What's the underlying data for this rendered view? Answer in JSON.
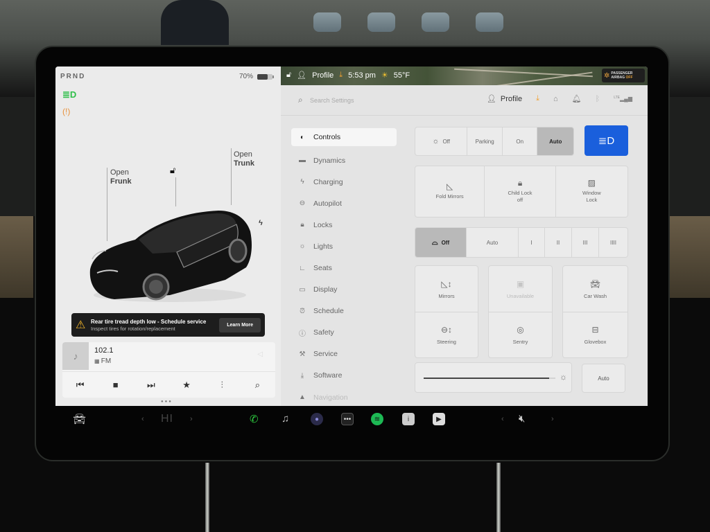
{
  "status": {
    "gear": "PRND",
    "battery_percent_label": "70%",
    "battery_level": 0.7
  },
  "car_view": {
    "frunk": {
      "line1": "Open",
      "line2": "Frunk"
    },
    "trunk": {
      "line1": "Open",
      "line2": "Trunk"
    },
    "lock_icon": "unlocked-lock-icon",
    "charge_icon": "lightning-icon"
  },
  "indicators": {
    "headlight_color": "#2fbf4a",
    "tpms_color": "#e8913a"
  },
  "alert": {
    "title": "Rear tire tread depth low - Schedule service",
    "subtitle": "Inspect tires for rotation/replacement",
    "button": "Learn More"
  },
  "media": {
    "station": "102.1",
    "band": "FM",
    "controls": [
      "previous",
      "stop",
      "next",
      "favorite",
      "equalizer",
      "search"
    ]
  },
  "map_bar": {
    "profile": "Profile",
    "time": "5:53 pm",
    "temperature": "55°F",
    "airbag_line1": "PASSENGER",
    "airbag_line2": "AIRBAG",
    "airbag_state": "OFF"
  },
  "topbar": {
    "search_placeholder": "Search Settings",
    "profile": "Profile",
    "network": "LTE"
  },
  "nav": {
    "items": [
      {
        "label": "Controls",
        "icon": "toggle-icon",
        "active": true
      },
      {
        "label": "Dynamics",
        "icon": "car-icon"
      },
      {
        "label": "Charging",
        "icon": "lightning-icon"
      },
      {
        "label": "Autopilot",
        "icon": "steering-wheel-icon"
      },
      {
        "label": "Locks",
        "icon": "lock-icon"
      },
      {
        "label": "Lights",
        "icon": "light-bulb-icon"
      },
      {
        "label": "Seats",
        "icon": "seat-icon"
      },
      {
        "label": "Display",
        "icon": "display-icon"
      },
      {
        "label": "Schedule",
        "icon": "alarm-clock-icon"
      },
      {
        "label": "Safety",
        "icon": "safety-icon"
      },
      {
        "label": "Service",
        "icon": "wrench-icon"
      },
      {
        "label": "Software",
        "icon": "download-icon"
      },
      {
        "label": "Navigation",
        "icon": "navigation-icon"
      }
    ]
  },
  "controls": {
    "lights": {
      "options": [
        "Off",
        "Parking",
        "On",
        "Auto"
      ],
      "selected": "Auto"
    },
    "tiles_row": [
      {
        "label": "Fold Mirrors",
        "sub": ""
      },
      {
        "label": "Child Lock",
        "sub": "off"
      },
      {
        "label": "Window",
        "sub": "Lock"
      }
    ],
    "wipers": {
      "options": [
        "Off",
        "Auto",
        "I",
        "II",
        "III",
        "IIII"
      ],
      "selected": "Off"
    },
    "grid": {
      "col1": [
        "Mirrors",
        "Steering"
      ],
      "col2": [
        "Unavailable",
        "Sentry"
      ],
      "col3": [
        "Car Wash",
        "Glovebox"
      ]
    },
    "brightness": {
      "level": 0.95,
      "auto_label": "Auto"
    }
  },
  "dock": {
    "temperature": "HI",
    "volume": "muted"
  }
}
